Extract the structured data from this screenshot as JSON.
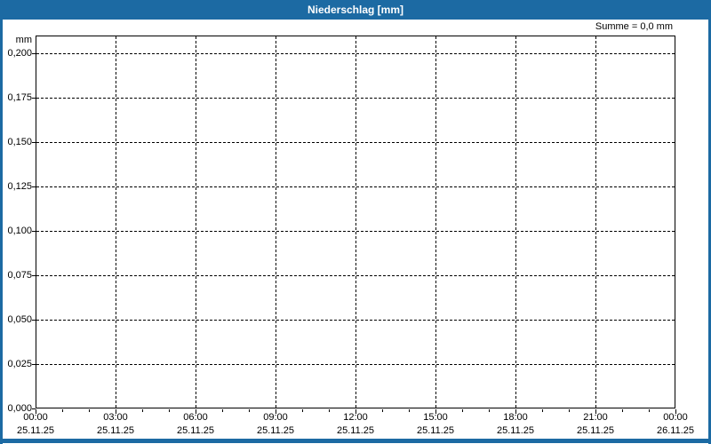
{
  "window": {
    "title": "Niederschlag [mm]"
  },
  "colors": {
    "titlebar": "#1c6aa3",
    "border": "#1c6aa3",
    "grid": "#000000",
    "background": "#ffffff",
    "text": "#000000",
    "title_text": "#ffffff"
  },
  "chart_data": {
    "type": "bar",
    "title": "Niederschlag [mm]",
    "ylabel": "mm",
    "xlabel": "",
    "sum_label": "Summe = 0,0 mm",
    "ylim": [
      0.0,
      0.21
    ],
    "grid": "dashed black gridlines on white, both axes",
    "legend": "none",
    "y_axis": {
      "unit": "mm",
      "tick_labels": [
        "0,200",
        "0,175",
        "0,150",
        "0,125",
        "0,100",
        "0,075",
        "0,050",
        "0,025",
        "0,000"
      ],
      "tick_values": [
        0.2,
        0.175,
        0.15,
        0.125,
        0.1,
        0.075,
        0.05,
        0.025,
        0.0
      ]
    },
    "x_axis": {
      "minor_tick_interval_hours": 1,
      "major_tick_interval_hours": 3,
      "ticks": [
        {
          "time": "00:00",
          "date": "25.11.25"
        },
        {
          "time": "03:00",
          "date": "25.11.25"
        },
        {
          "time": "06:00",
          "date": "25.11.25"
        },
        {
          "time": "09:00",
          "date": "25.11.25"
        },
        {
          "time": "12:00",
          "date": "25.11.25"
        },
        {
          "time": "15:00",
          "date": "25.11.25"
        },
        {
          "time": "18:00",
          "date": "25.11.25"
        },
        {
          "time": "21:00",
          "date": "25.11.25"
        },
        {
          "time": "00:00",
          "date": "26.11.25"
        }
      ]
    },
    "series": [
      {
        "name": "Niederschlag",
        "values": []
      }
    ]
  }
}
